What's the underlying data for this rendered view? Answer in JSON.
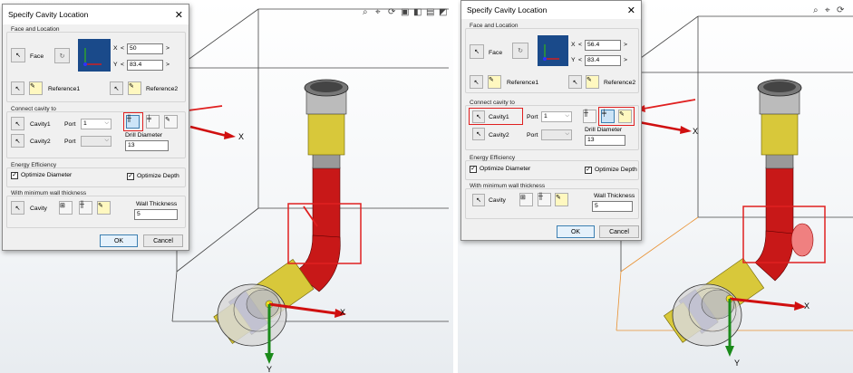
{
  "left": {
    "dialog": {
      "title": "Specify Cavity Location",
      "face_location_label": "Face and Location",
      "face_label": "Face",
      "x_label": "X",
      "x_value": "50",
      "y_label": "Y",
      "y_value": "83.4",
      "lt": "<",
      "gt": ">",
      "reference1": "Reference1",
      "reference2": "Reference2",
      "connect_label": "Connect cavity to",
      "cavity1": "Cavity1",
      "cavity2": "Cavity2",
      "port_label": "Port",
      "port_value": "1",
      "drill_label": "Drill Diameter",
      "drill_value": "13",
      "energy_label": "Energy Efficiency",
      "opt_diameter": "Optimize Diameter",
      "opt_depth": "Optimize Depth",
      "wall_group_label": "With minimum wall thickness",
      "cavity_label": "Cavity",
      "wall_label": "Wall Thickness",
      "wall_value": "5",
      "ok": "OK",
      "cancel": "Cancel"
    },
    "axis_x": "X",
    "axis_y": "Y"
  },
  "right": {
    "dialog": {
      "title": "Specify Cavity Location",
      "face_location_label": "Face and Location",
      "face_label": "Face",
      "x_label": "X",
      "x_value": "56.4",
      "y_label": "Y",
      "y_value": "83.4",
      "lt": "<",
      "gt": ">",
      "reference1": "Reference1",
      "reference2": "Reference2",
      "connect_label": "Connect cavity to",
      "cavity1": "Cavity1",
      "cavity2": "Cavity2",
      "port_label": "Port",
      "port_value": "1",
      "drill_label": "Drill Diameter",
      "drill_value": "13",
      "energy_label": "Energy Efficiency",
      "opt_diameter": "Optimize Diameter",
      "opt_depth": "Optimize Depth",
      "wall_group_label": "With minimum wall thickness",
      "cavity_label": "Cavity",
      "wall_label": "Wall Thickness",
      "wall_value": "5",
      "ok": "OK",
      "cancel": "Cancel"
    },
    "axis_x": "X",
    "axis_y": "Y"
  },
  "icons": [
    "zoom-icon",
    "zoom-area-icon",
    "rotate-icon",
    "view-orient-icon",
    "display-style-icon"
  ],
  "colors": {
    "highlight": "#e02020",
    "dialog_bg": "#f0f0f0",
    "cavity_red": "#c81818",
    "gold": "#d8c83a",
    "axis_green": "#1a8a1a"
  }
}
